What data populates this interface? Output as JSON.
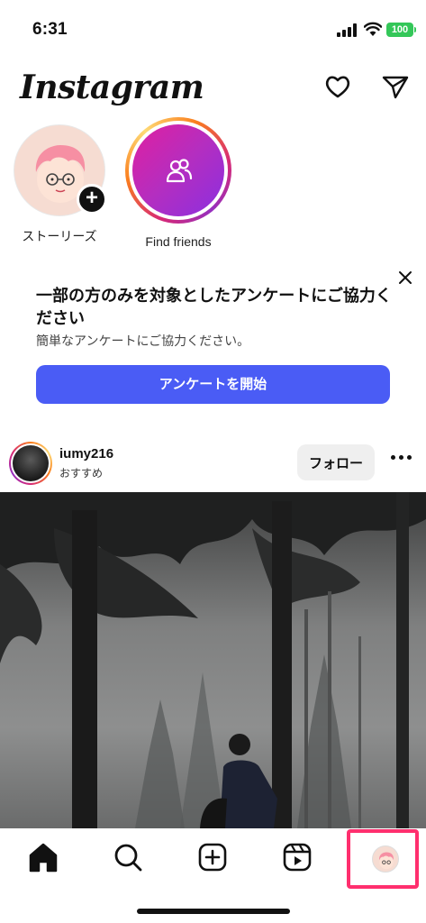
{
  "status_bar": {
    "time": "6:31",
    "battery": "100"
  },
  "header": {
    "logo": "Instagram",
    "icons": [
      "heart-icon",
      "send-icon"
    ]
  },
  "stories": [
    {
      "label": "ストーリーズ",
      "icon": "add-icon"
    },
    {
      "label": "Find friends",
      "icon": "people-icon"
    }
  ],
  "survey": {
    "title": "一部の方のみを対象としたアンケートにご協力ください",
    "subtitle": "簡単なアンケートにご協力ください。",
    "button": "アンケートを開始"
  },
  "post": {
    "username": "iumy216",
    "subtitle": "おすすめ",
    "follow_label": "フォロー"
  },
  "bottom_nav": [
    "home-icon",
    "search-icon",
    "create-icon",
    "reels-icon",
    "profile-avatar"
  ],
  "colors": {
    "survey_button": "#4a5cf5",
    "highlight": "#ff2f6e",
    "battery": "#34c759"
  }
}
